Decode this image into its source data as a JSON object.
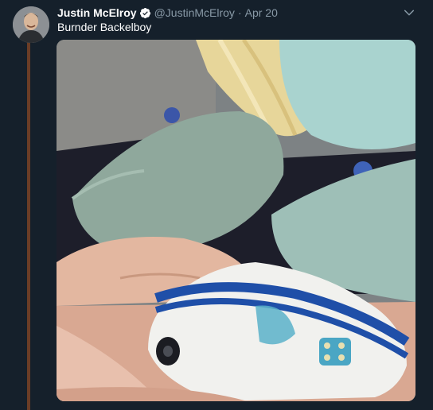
{
  "tweet": {
    "author_name": "Justin McElroy",
    "handle": "@JustinMcElroy",
    "separator": "·",
    "date": "Apr 20",
    "text": "Burnder Backelboy",
    "verified": true,
    "icons": {
      "verified": "verified-badge-icon",
      "more": "chevron-down-icon",
      "media": "photo"
    },
    "colors": {
      "background": "#15202b",
      "thread_line": "#6b3d26",
      "secondary_text": "#8899a6",
      "primary_text": "#ffffff"
    }
  }
}
